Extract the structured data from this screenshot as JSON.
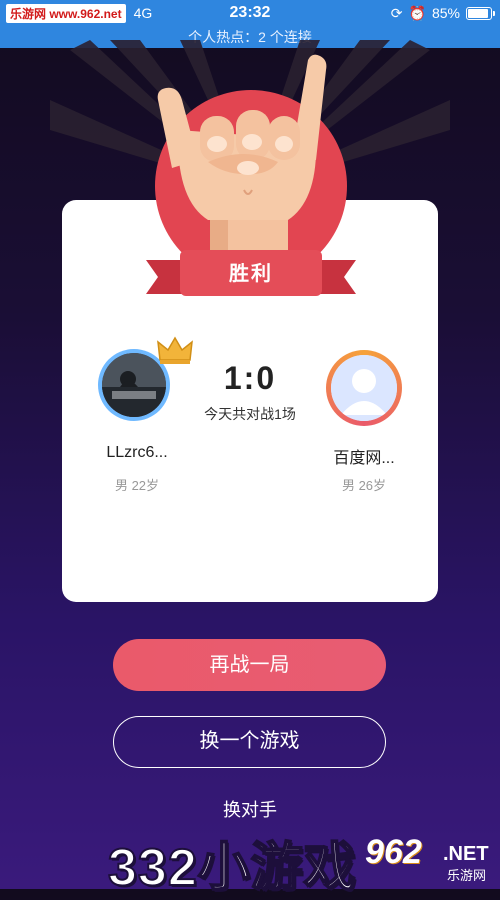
{
  "status_bar": {
    "site_tag": "乐游网 www.962.net",
    "network": "4G",
    "time": "23:32",
    "battery_percent": "85%",
    "battery_level": 0.85
  },
  "hotspot": {
    "text": "个人热点：2 个连接"
  },
  "result": {
    "label": "胜利"
  },
  "match": {
    "score": "1:0",
    "battle_count": "今天共对战1场"
  },
  "player_left": {
    "name": "LLzrc6...",
    "meta": "男 22岁"
  },
  "player_right": {
    "name": "百度网...",
    "meta": "男 26岁"
  },
  "buttons": {
    "rematch": "再战一局",
    "switch_game": "换一个游戏",
    "switch_opponent": "换对手"
  },
  "watermark": {
    "text": "332小游戏",
    "logo_number": "962",
    "logo_net": ".NET",
    "logo_sub": "乐游网"
  },
  "colors": {
    "status_bar": "#2f86df",
    "accent_red": "#e24551",
    "card": "#ffffff"
  }
}
